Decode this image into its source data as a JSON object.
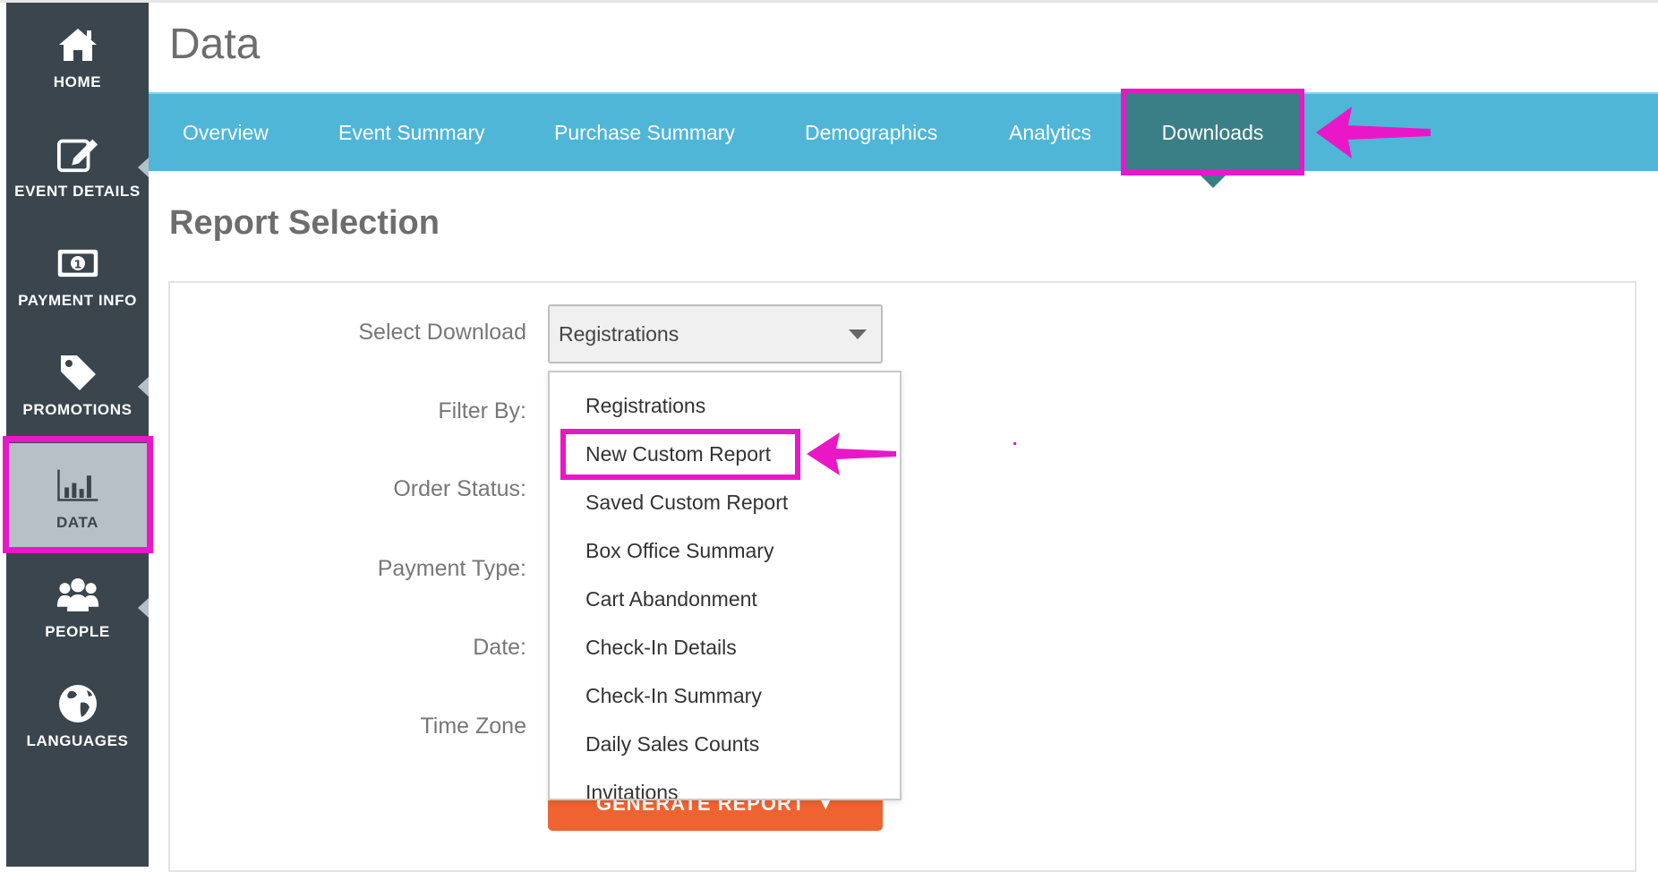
{
  "page": {
    "title": "Data"
  },
  "sidebar": {
    "items": [
      {
        "label": "HOME",
        "icon": "home-icon"
      },
      {
        "label": "EVENT DETAILS",
        "icon": "edit-icon"
      },
      {
        "label": "PAYMENT INFO",
        "icon": "money-icon"
      },
      {
        "label": "PROMOTIONS",
        "icon": "tag-icon"
      },
      {
        "label": "DATA",
        "icon": "bar-chart-icon",
        "active": true
      },
      {
        "label": "PEOPLE",
        "icon": "people-icon"
      },
      {
        "label": "LANGUAGES",
        "icon": "globe-icon"
      }
    ]
  },
  "tabs": [
    {
      "label": "Overview"
    },
    {
      "label": "Event Summary"
    },
    {
      "label": "Purchase Summary"
    },
    {
      "label": "Demographics"
    },
    {
      "label": "Analytics"
    },
    {
      "label": "Downloads",
      "active": true
    }
  ],
  "section": {
    "title": "Report Selection"
  },
  "form": {
    "select_download_label": "Select Download",
    "filter_by_label": "Filter By:",
    "order_status_label": "Order Status:",
    "payment_type_label": "Payment Type:",
    "date_label": "Date:",
    "time_zone_label": "Time Zone",
    "select_download_value": "Registrations",
    "generate_button": "GENERATE REPORT"
  },
  "dropdown": {
    "options": [
      "Registrations",
      "New Custom Report",
      "Saved Custom Report",
      "Box Office Summary",
      "Cart Abandonment",
      "Check-In Details",
      "Check-In Summary",
      "Daily Sales Counts",
      "Invitations"
    ],
    "highlighted": "New Custom Report"
  },
  "colors": {
    "sidebar_bg": "#3a454d",
    "tabbar_bg": "#4fb6d8",
    "active_tab_bg": "#3a7f86",
    "highlight": "#ea17c9",
    "button_bg": "#ef6331"
  }
}
